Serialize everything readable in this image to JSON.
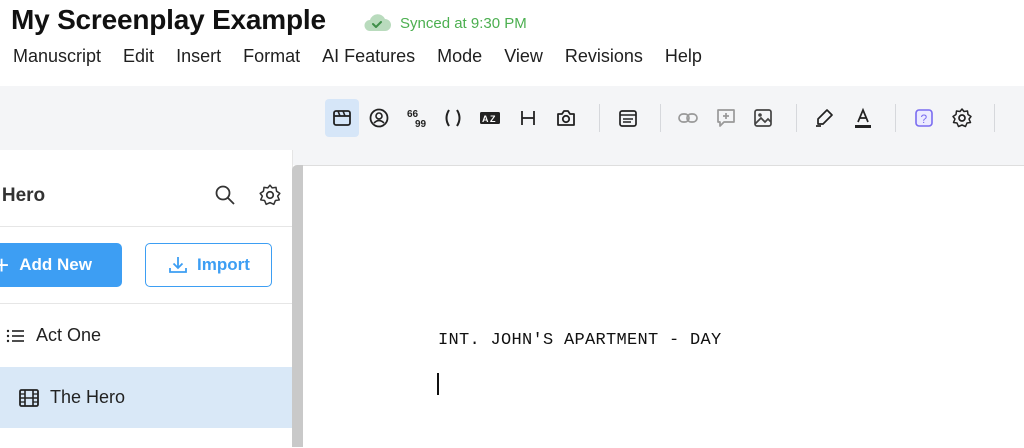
{
  "window": {
    "title": "My Screenplay Example",
    "sync_status": "Synced at 9:30 PM"
  },
  "menu": [
    "Manuscript",
    "Edit",
    "Insert",
    "Format",
    "AI Features",
    "Mode",
    "View",
    "Revisions",
    "Help"
  ],
  "toolbar": {
    "buttons": [
      {
        "name": "scene-heading-icon",
        "active": true
      },
      {
        "name": "character-icon"
      },
      {
        "name": "dialogue-quote-icon",
        "text": "66 99"
      },
      {
        "name": "parenthetical-icon",
        "text": "( )"
      },
      {
        "name": "action-icon"
      },
      {
        "name": "heading-icon",
        "text": "H"
      },
      {
        "name": "shot-camera-icon"
      },
      {
        "name": "note-card-icon"
      },
      {
        "name": "link-icon"
      },
      {
        "name": "add-comment-icon"
      },
      {
        "name": "image-icon"
      },
      {
        "name": "highlighter-icon"
      },
      {
        "name": "text-color-icon",
        "text": "A"
      },
      {
        "name": "help-icon"
      },
      {
        "name": "settings-icon"
      }
    ]
  },
  "sidebar": {
    "title": "e Hero",
    "add_button": "Add New",
    "import_button": "Import",
    "items": [
      {
        "label": "Act One",
        "icon": "list-icon",
        "selected": false
      },
      {
        "label": "The Hero",
        "icon": "film-icon",
        "selected": true
      }
    ]
  },
  "editor": {
    "scene_heading": "INT. JOHN'S APARTMENT - DAY"
  },
  "colors": {
    "accent": "#3d9ef3",
    "sync_green": "#4caf50",
    "selected_bg": "#d9e8f7",
    "toolbar_bg": "#f4f5f7"
  }
}
